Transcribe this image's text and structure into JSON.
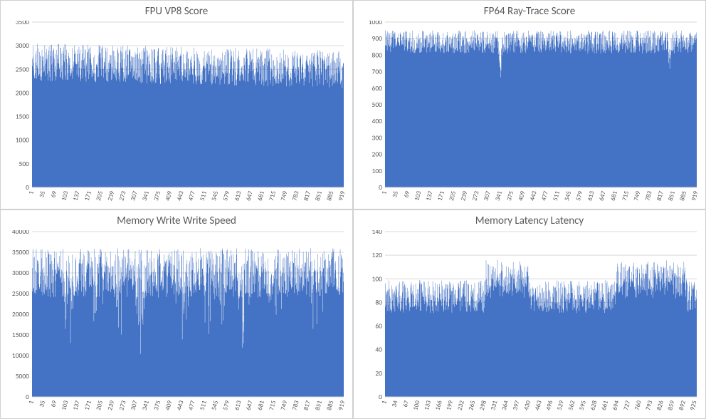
{
  "chart_data": [
    {
      "id": "fpu_vp8",
      "type": "bar",
      "title": "FPU VP8 Score",
      "ylim": [
        0,
        3500
      ],
      "ystep": 500,
      "x_ticks": [
        1,
        35,
        69,
        103,
        137,
        171,
        205,
        239,
        273,
        307,
        341,
        375,
        409,
        443,
        477,
        511,
        545,
        579,
        613,
        647,
        681,
        715,
        749,
        783,
        817,
        851,
        885,
        919
      ],
      "n": 920,
      "value_profile": {
        "description": "Dense noisy bars mostly between ~2200 and ~2950, slight downward drift toward the right.",
        "base": 2650,
        "jitter": 400,
        "drift": -150
      }
    },
    {
      "id": "fp64_rt",
      "type": "bar",
      "title": "FP64 Ray-Trace Score",
      "ylim": [
        0,
        1000
      ],
      "ystep": 100,
      "x_ticks": [
        1,
        35,
        69,
        103,
        137,
        171,
        205,
        239,
        273,
        307,
        341,
        375,
        409,
        443,
        477,
        511,
        545,
        579,
        613,
        647,
        681,
        715,
        749,
        783,
        817,
        851,
        885,
        919
      ],
      "n": 920,
      "value_profile": {
        "description": "Dense bars mostly ~820–920, a few dips near ~700 around index ~340 and ~840.",
        "base": 880,
        "jitter": 70,
        "dips": [
          {
            "at": 340,
            "depth": 180,
            "width": 6
          },
          {
            "at": 840,
            "depth": 120,
            "width": 6
          }
        ]
      }
    },
    {
      "id": "mem_write",
      "type": "bar",
      "title": "Memory Write Write Speed",
      "ylim": [
        0,
        40000
      ],
      "ystep": 5000,
      "x_ticks": [
        1,
        35,
        69,
        103,
        137,
        171,
        205,
        239,
        273,
        307,
        341,
        375,
        409,
        443,
        477,
        511,
        545,
        579,
        613,
        647,
        681,
        715,
        749,
        783,
        817,
        851,
        885,
        919
      ],
      "n": 920,
      "value_profile": {
        "description": "Highly variable bars ~15000–35000 with deep troughs down to ~13000 in clusters.",
        "base": 30000,
        "jitter": 6000,
        "trough_depth": 17000,
        "trough_clusters": [
          110,
          190,
          260,
          320,
          440,
          520,
          560,
          620,
          720,
          840
        ]
      }
    },
    {
      "id": "mem_lat",
      "type": "bar",
      "title": "Memory Latency Latency",
      "ylim": [
        0,
        140
      ],
      "ystep": 20,
      "x_ticks": [
        1,
        34,
        67,
        100,
        133,
        166,
        199,
        232,
        265,
        298,
        331,
        364,
        397,
        430,
        463,
        496,
        529,
        562,
        595,
        628,
        661,
        694,
        727,
        760,
        793,
        826,
        859,
        892,
        925
      ],
      "n": 930,
      "value_profile": {
        "description": "Bars mostly ~78–105 with stretches of higher plateaus ~100–115 between indices ~300–430 and ~690–900.",
        "base": 85,
        "jitter": 14,
        "plateaus": [
          {
            "from": 300,
            "to": 430,
            "add": 15
          },
          {
            "from": 690,
            "to": 900,
            "add": 15
          }
        ]
      }
    }
  ]
}
